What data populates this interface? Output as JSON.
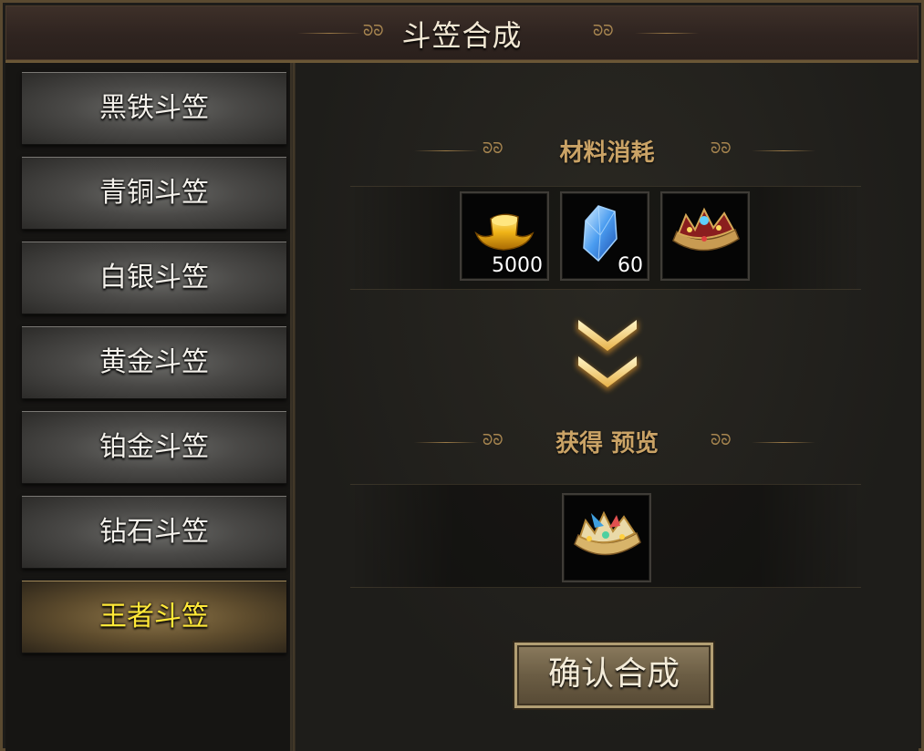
{
  "window": {
    "title": "斗笠合成"
  },
  "sidebar": {
    "items": [
      {
        "label": "黑铁斗笠",
        "active": false
      },
      {
        "label": "青铜斗笠",
        "active": false
      },
      {
        "label": "白银斗笠",
        "active": false
      },
      {
        "label": "黄金斗笠",
        "active": false
      },
      {
        "label": "铂金斗笠",
        "active": false
      },
      {
        "label": "钻石斗笠",
        "active": false
      },
      {
        "label": "王者斗笠",
        "active": true
      }
    ]
  },
  "materials": {
    "title": "材料消耗",
    "items": [
      {
        "icon": "gold-ingot-icon",
        "count": "5000"
      },
      {
        "icon": "blue-crystal-icon",
        "count": "60"
      },
      {
        "icon": "diamond-crown-icon",
        "count": ""
      }
    ]
  },
  "preview": {
    "title": "获得 预览",
    "items": [
      {
        "icon": "king-crown-icon"
      }
    ]
  },
  "actions": {
    "confirm_label": "确认合成"
  },
  "colors": {
    "accent_gold": "#caa366",
    "active_tab_text": "#ffe838",
    "tab_text": "#f3f0ea"
  }
}
